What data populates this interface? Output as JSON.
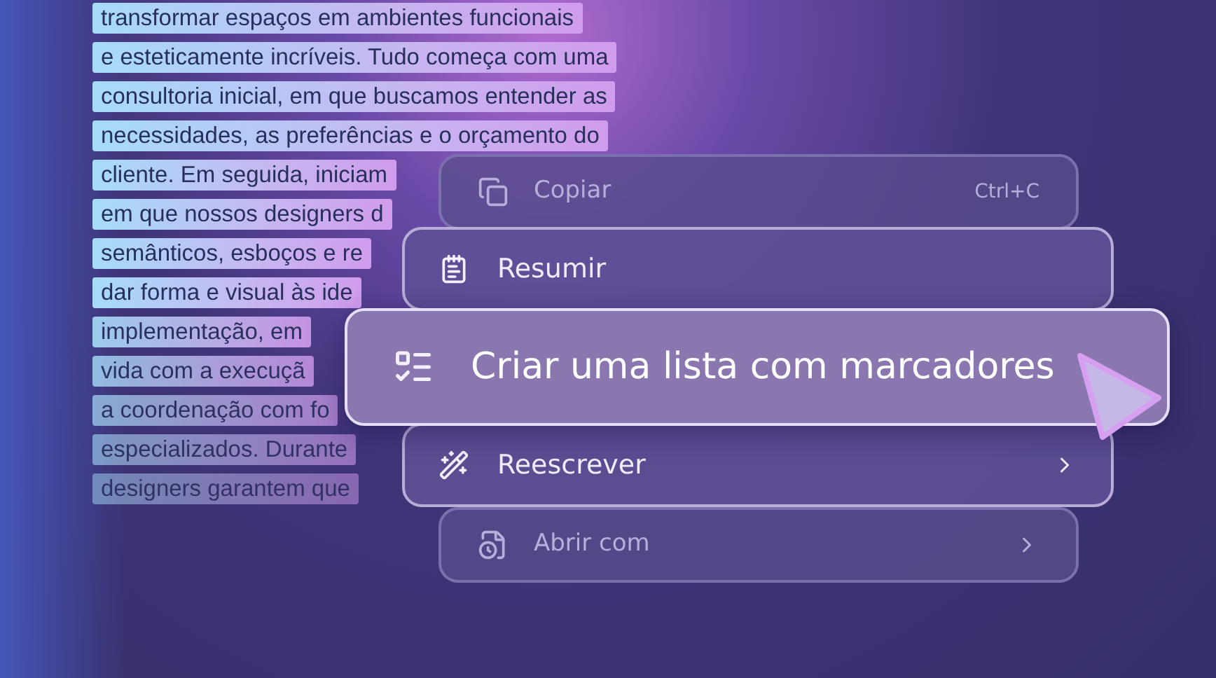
{
  "document": {
    "lines": [
      "transformar espaços em ambientes funcionais",
      "e esteticamente incríveis. Tudo começa com uma",
      "consultoria inicial, em que buscamos entender as",
      "necessidades, as preferências e o orçamento do",
      "cliente. Em seguida, iniciam",
      "em que nossos designers d",
      "semânticos, esboços e re",
      "dar forma e visual às ide",
      "implementação, em",
      "vida com a execuçã",
      "a coordenação com fo",
      "especializados. Durante",
      "designers garantem que"
    ]
  },
  "menu": {
    "items": [
      {
        "kind": "copy",
        "label": "Copiar",
        "shortcut": "Ctrl+C",
        "submenu": false,
        "selected": false,
        "dimmed": true
      },
      {
        "kind": "summarize",
        "label": "Resumir",
        "submenu": false,
        "selected": false,
        "dimmed": false
      },
      {
        "kind": "list",
        "label": "Criar uma lista com marcadores",
        "submenu": false,
        "selected": true,
        "dimmed": false
      },
      {
        "kind": "rewrite",
        "label": "Reescrever",
        "submenu": true,
        "selected": false,
        "dimmed": false
      },
      {
        "kind": "open",
        "label": "Abrir com",
        "submenu": true,
        "selected": false,
        "dimmed": true
      }
    ]
  }
}
